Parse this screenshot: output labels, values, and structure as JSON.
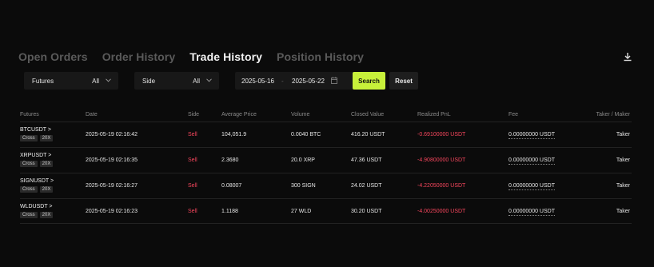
{
  "tabs": [
    {
      "label": "Open Orders",
      "active": false
    },
    {
      "label": "Order History",
      "active": false
    },
    {
      "label": "Trade History",
      "active": true
    },
    {
      "label": "Position History",
      "active": false
    }
  ],
  "toolbar": {
    "download_icon": "download-icon"
  },
  "filters": {
    "instrument": {
      "label": "Futures",
      "value": "All"
    },
    "side": {
      "label": "Side",
      "value": "All"
    },
    "date_from": "2025-05-16",
    "date_sep": "-",
    "date_to": "2025-05-22",
    "search_label": "Search",
    "reset_label": "Reset"
  },
  "table": {
    "headers": {
      "futures": "Futures",
      "date": "Date",
      "side": "Side",
      "price": "Average Price",
      "volume": "Volume",
      "closed": "Closed Value",
      "pnl": "Realized PnL",
      "fee": "Fee",
      "taker_maker": "Taker / Maker"
    },
    "rows": [
      {
        "symbol": "BTCUSDT >",
        "margin": "Cross",
        "leverage": "20X",
        "date": "2025-05-19 02:16:42",
        "side": "Sell",
        "price": "104,051.9",
        "volume": "0.0040  BTC",
        "closed": "416.20 USDT",
        "pnl": "-0.69100000 USDT",
        "fee": "0.00000000 USDT",
        "taker_maker": "Taker"
      },
      {
        "symbol": "XRPUSDT >",
        "margin": "Cross",
        "leverage": "20X",
        "date": "2025-05-19 02:16:35",
        "side": "Sell",
        "price": "2.3680",
        "volume": "20.0  XRP",
        "closed": "47.36 USDT",
        "pnl": "-4.90800000 USDT",
        "fee": "0.00000000 USDT",
        "taker_maker": "Taker"
      },
      {
        "symbol": "SIGNUSDT >",
        "margin": "Cross",
        "leverage": "20X",
        "date": "2025-05-19 02:16:27",
        "side": "Sell",
        "price": "0.08007",
        "volume": "300  SIGN",
        "closed": "24.02 USDT",
        "pnl": "-4.22050000 USDT",
        "fee": "0.00000000 USDT",
        "taker_maker": "Taker"
      },
      {
        "symbol": "WLDUSDT >",
        "margin": "Cross",
        "leverage": "20X",
        "date": "2025-05-19 02:16:23",
        "side": "Sell",
        "price": "1.1188",
        "volume": "27  WLD",
        "closed": "30.20 USDT",
        "pnl": "-4.00250000 USDT",
        "fee": "0.00000000 USDT",
        "taker_maker": "Taker"
      }
    ]
  },
  "colors": {
    "accent": "#c7f03a",
    "sell": "#f6465d",
    "background": "#0b0b0b"
  }
}
